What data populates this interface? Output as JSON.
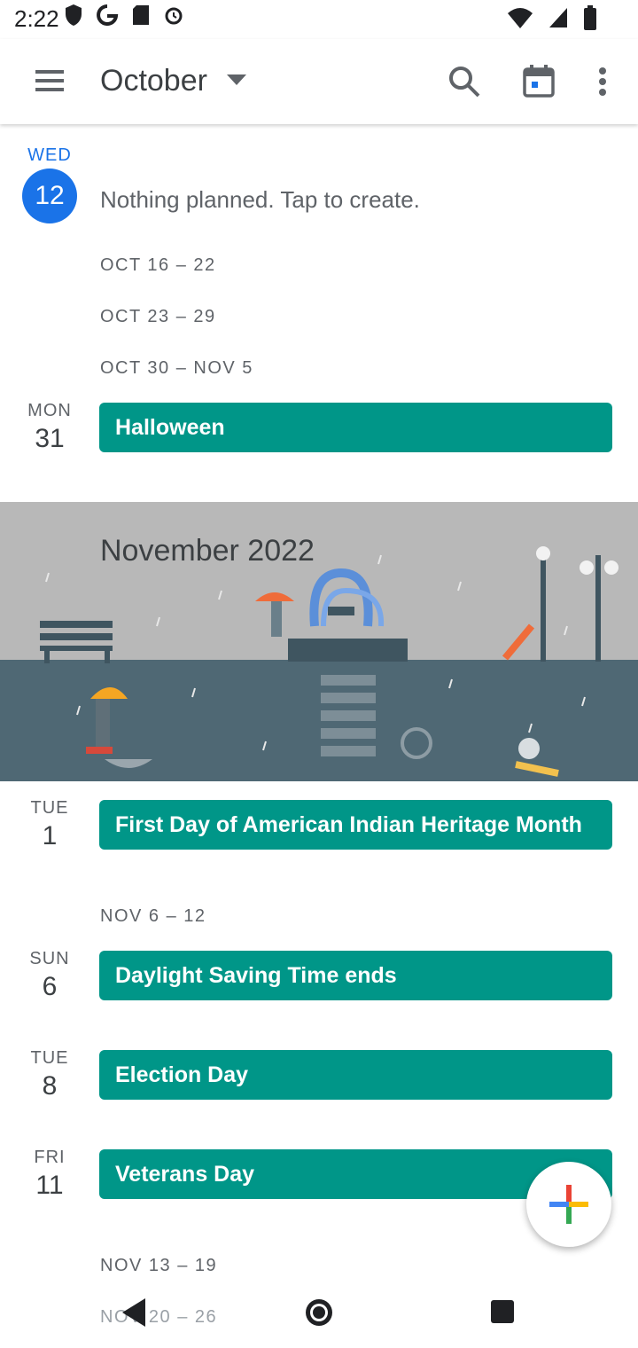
{
  "status_bar": {
    "time": "2:22"
  },
  "header": {
    "month": "October"
  },
  "today": {
    "dow": "WED",
    "day": "12",
    "empty_text": "Nothing planned. Tap to create."
  },
  "ranges": {
    "r1": "OCT 16 – 22",
    "r2": "OCT 23 – 29",
    "r3": "OCT 30 – NOV 5",
    "r4": "NOV 6 – 12",
    "r5": "NOV 13 – 19",
    "r6": "NOV 20 – 26"
  },
  "days": [
    {
      "dow": "MON",
      "day": "31",
      "event": "Halloween"
    },
    {
      "dow": "TUE",
      "day": "1",
      "event": "First Day of American Indian Heritage Month"
    },
    {
      "dow": "SUN",
      "day": "6",
      "event": "Daylight Saving Time ends"
    },
    {
      "dow": "TUE",
      "day": "8",
      "event": "Election Day"
    },
    {
      "dow": "FRI",
      "day": "11",
      "event": "Veterans Day"
    }
  ],
  "banner": {
    "title": "November 2022"
  },
  "colors": {
    "accent": "#1a73e8",
    "event": "#009688"
  }
}
